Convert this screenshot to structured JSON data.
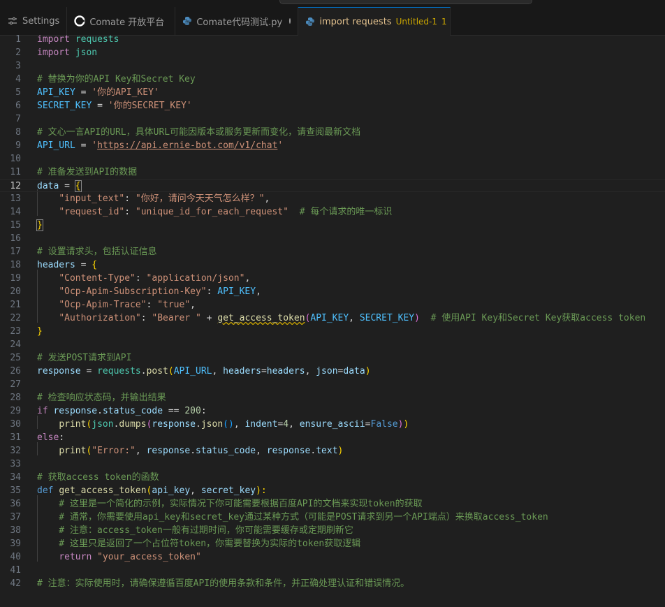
{
  "tabs": [
    {
      "label": "Settings",
      "icon": "settings-icon"
    },
    {
      "label": "Comate 开放平台",
      "icon": "comate-icon"
    },
    {
      "label": "Comate代码测试.py",
      "icon": "python-icon",
      "modified": true
    },
    {
      "label": "import requests",
      "description": "Untitled-1",
      "badge": "1",
      "icon": "python-icon",
      "modified": true,
      "active": true
    }
  ],
  "editor": {
    "current_line": 12,
    "lines": [
      {
        "n": "1"
      },
      {
        "n": "2"
      },
      {
        "n": "3"
      },
      {
        "n": "4"
      },
      {
        "n": "5"
      },
      {
        "n": "6"
      },
      {
        "n": "7"
      },
      {
        "n": "8"
      },
      {
        "n": "9"
      },
      {
        "n": "10"
      },
      {
        "n": "11"
      },
      {
        "n": "12"
      },
      {
        "n": "13"
      },
      {
        "n": "14"
      },
      {
        "n": "15"
      },
      {
        "n": "16"
      },
      {
        "n": "17"
      },
      {
        "n": "18"
      },
      {
        "n": "19"
      },
      {
        "n": "20"
      },
      {
        "n": "21"
      },
      {
        "n": "22"
      },
      {
        "n": "23"
      },
      {
        "n": "24"
      },
      {
        "n": "25"
      },
      {
        "n": "26"
      },
      {
        "n": "27"
      },
      {
        "n": "28"
      },
      {
        "n": "29"
      },
      {
        "n": "30"
      },
      {
        "n": "31"
      },
      {
        "n": "32"
      },
      {
        "n": "33"
      },
      {
        "n": "34"
      },
      {
        "n": "35"
      },
      {
        "n": "36"
      },
      {
        "n": "37"
      },
      {
        "n": "38"
      },
      {
        "n": "39"
      },
      {
        "n": "40"
      },
      {
        "n": "41"
      },
      {
        "n": "42"
      }
    ],
    "code": {
      "l1": [
        "import",
        " ",
        "requests"
      ],
      "l2": [
        "import",
        " ",
        "json"
      ],
      "l4": "# 替换为你的API Key和Secret Key",
      "l5": [
        "API_KEY",
        " = ",
        "'你的API_KEY'"
      ],
      "l6": [
        "SECRET_KEY",
        " = ",
        "'你的SECRET_KEY'"
      ],
      "l8": "# 文心一言API的URL，具体URL可能因版本或服务更新而变化，请查阅最新文档",
      "l9": [
        "API_URL",
        " = ",
        "'",
        "https://api.ernie-bot.com/v1/chat",
        "'"
      ],
      "l11": "# 准备发送到API的数据",
      "l12": [
        "data",
        " = ",
        "{"
      ],
      "l13": [
        "    ",
        "\"input_text\"",
        ": ",
        "\"你好，请问今天天气怎么样？\"",
        ","
      ],
      "l14": [
        "    ",
        "\"request_id\"",
        ": ",
        "\"unique_id_for_each_request\"",
        "  ",
        "# 每个请求的唯一标识"
      ],
      "l15": [
        "}"
      ],
      "l17": "# 设置请求头，包括认证信息",
      "l18": [
        "headers",
        " = ",
        "{"
      ],
      "l19": [
        "    ",
        "\"Content-Type\"",
        ": ",
        "\"application/json\"",
        ","
      ],
      "l20": [
        "    ",
        "\"Ocp-Apim-Subscription-Key\"",
        ": ",
        "API_KEY",
        ","
      ],
      "l21": [
        "    ",
        "\"Ocp-Apim-Trace\"",
        ": ",
        "\"true\"",
        ","
      ],
      "l22": [
        "    ",
        "\"Authorization\"",
        ": ",
        "\"Bearer \"",
        " + ",
        "get_access_token",
        "(",
        "API_KEY",
        ", ",
        "SECRET_KEY",
        ")",
        "  ",
        "# 使用API Key和Secret Key获取access token"
      ],
      "l23": [
        "}"
      ],
      "l25": "# 发送POST请求到API",
      "l26": [
        "response",
        " = ",
        "requests",
        ".",
        "post",
        "(",
        "API_URL",
        ", ",
        "headers",
        "=",
        "headers",
        ", ",
        "json",
        "=",
        "data",
        ")"
      ],
      "l28": "# 检查响应状态码，并输出结果",
      "l29": [
        "if",
        " ",
        "response",
        ".",
        "status_code",
        " == ",
        "200",
        ":"
      ],
      "l30": [
        "    ",
        "print",
        "(",
        "json",
        ".",
        "dumps",
        "(",
        "response",
        ".",
        "json",
        "()",
        ", ",
        "indent",
        "=",
        "4",
        ", ",
        "ensure_ascii",
        "=",
        "False",
        ")",
        ")"
      ],
      "l31": [
        "else",
        ":"
      ],
      "l32": [
        "    ",
        "print",
        "(",
        "\"Error:\"",
        ", ",
        "response",
        ".",
        "status_code",
        ", ",
        "response",
        ".",
        "text",
        ")"
      ],
      "l34": "# 获取access token的函数",
      "l35": [
        "def",
        " ",
        "get_access_token",
        "(",
        "api_key",
        ", ",
        "secret_key",
        "):"
      ],
      "l36": "    # 这里是一个简化的示例，实际情况下你可能需要根据百度API的文档来实现token的获取",
      "l37": "    # 通常，你需要使用api_key和secret_key通过某种方式（可能是POST请求到另一个API端点）来换取access_token",
      "l38": "    # 注意：access_token一般有过期时间，你可能需要缓存或定期刷新它",
      "l39": "    # 这里只是返回了一个占位符token，你需要替换为实际的token获取逻辑",
      "l40": [
        "    ",
        "return",
        " ",
        "\"your_access_token\""
      ],
      "l42": "# 注意：实际使用时，请确保遵循百度API的使用条款和条件，并正确处理认证和错误情况。"
    }
  }
}
